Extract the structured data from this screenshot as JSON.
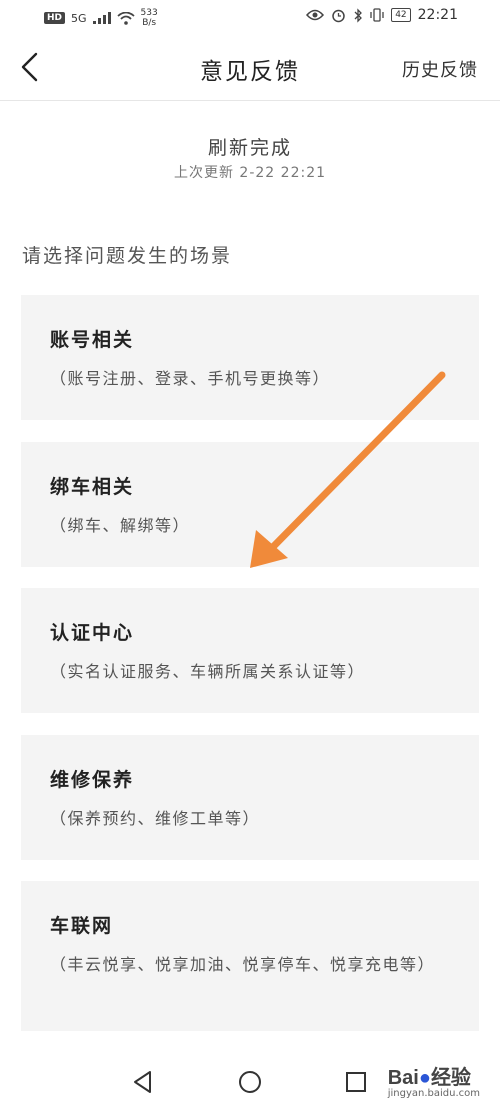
{
  "status_bar": {
    "network_badge": "HD",
    "network_type": "5G",
    "speed_value": "533",
    "speed_unit": "B/s",
    "battery": "42",
    "time": "22:21"
  },
  "navbar": {
    "title": "意见反馈",
    "history_label": "历史反馈"
  },
  "refresh": {
    "title": "刷新完成",
    "last_update": "上次更新 2-22 22:21"
  },
  "section_label": "请选择问题发生的场景",
  "cards": [
    {
      "title": "账号相关",
      "desc": "（账号注册、登录、手机号更换等）"
    },
    {
      "title": "绑车相关",
      "desc": "（绑车、解绑等）"
    },
    {
      "title": "认证中心",
      "desc": "（实名认证服务、车辆所属关系认证等）"
    },
    {
      "title": "维修保养",
      "desc": "（保养预约、维修工单等）"
    },
    {
      "title": "车联网",
      "desc": "（丰云悦享、悦享加油、悦享停车、悦享充电等）"
    }
  ],
  "watermark": {
    "brand_a": "Bai",
    "brand_b": "经验",
    "domain": "jingyan.baidu.com"
  },
  "colors": {
    "card_bg": "#f4f4f4",
    "arrow": "#f08a3a"
  }
}
